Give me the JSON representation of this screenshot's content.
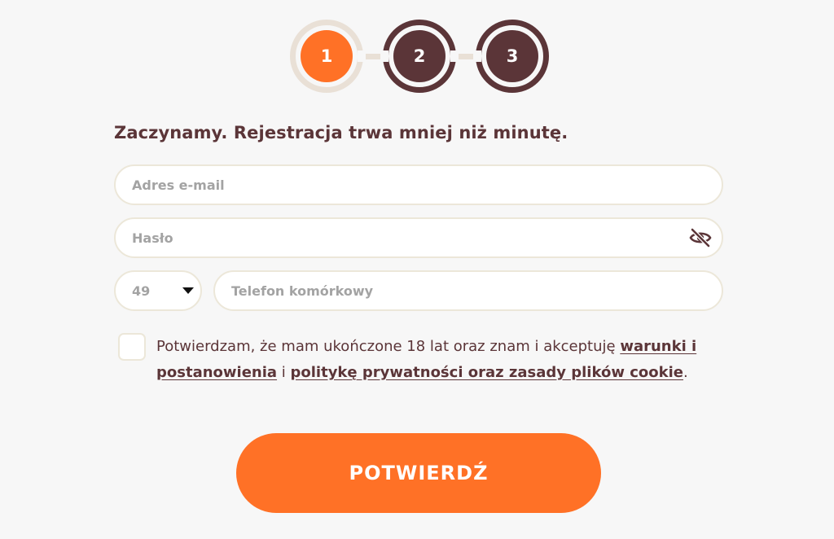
{
  "stepper": {
    "steps": [
      {
        "label": "1",
        "state": "active"
      },
      {
        "label": "2",
        "state": "upcoming"
      },
      {
        "label": "3",
        "state": "upcoming"
      }
    ]
  },
  "form": {
    "heading": "Zaczynamy. Rejestracja trwa mniej niż minutę.",
    "email": {
      "placeholder": "Adres e-mail",
      "value": ""
    },
    "password": {
      "placeholder": "Hasło",
      "value": "",
      "toggle_icon": "eye-off-icon"
    },
    "phone_code": {
      "value": "49"
    },
    "phone": {
      "placeholder": "Telefon komórkowy",
      "value": ""
    },
    "consent": {
      "checked": false,
      "text_before": "Potwierdzam, że mam ukończone 18 lat oraz znam i akceptuję ",
      "link1": "warunki i postanowienia",
      "middle": " i ",
      "link2": "politykę prywatności oraz zasady plików cookie",
      "text_after": "."
    },
    "submit_label": "POTWIERDŹ"
  },
  "colors": {
    "accent": "#ff7126",
    "brown": "#5b3538",
    "beige": "#e9e0d6",
    "background": "#f7f7f7"
  }
}
